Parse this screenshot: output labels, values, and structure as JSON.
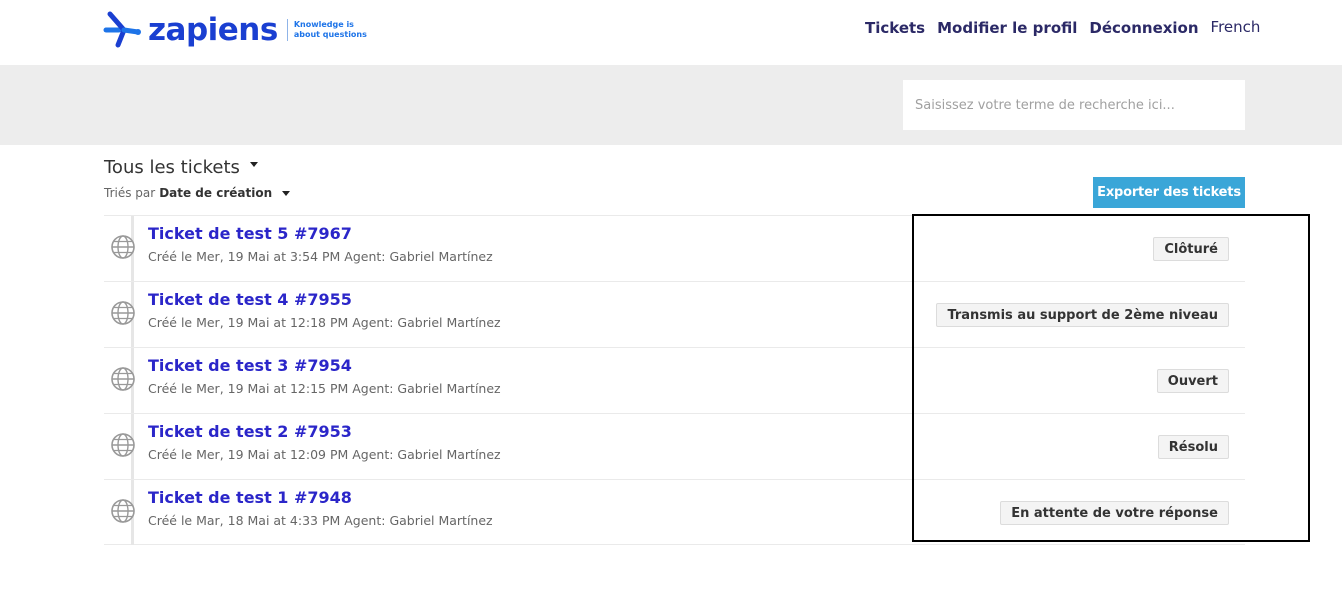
{
  "header": {
    "logo_word": "zapiens",
    "logo_tag_line1": "Knowledge is",
    "logo_tag_line2": "about questions",
    "nav": [
      {
        "label": "Tickets"
      },
      {
        "label": "Modifier le profil"
      },
      {
        "label": "Déconnexion"
      }
    ],
    "language": "French"
  },
  "search": {
    "placeholder": "Saisissez votre terme de recherche ici..."
  },
  "list": {
    "title": "Tous les tickets",
    "sort_prefix": "Triés par",
    "sort_value": "Date de création",
    "export_label": "Exporter des tickets"
  },
  "tickets": [
    {
      "title": "Ticket de test 5 #7967",
      "meta": "Créé le Mer, 19 Mai at 3:54 PM Agent: Gabriel Martínez",
      "status": "Clôturé"
    },
    {
      "title": "Ticket de test 4 #7955",
      "meta": "Créé le Mer, 19 Mai at 12:18 PM Agent: Gabriel Martínez",
      "status": "Transmis au support de 2ème niveau"
    },
    {
      "title": "Ticket de test 3 #7954",
      "meta": "Créé le Mer, 19 Mai at 12:15 PM Agent: Gabriel Martínez",
      "status": "Ouvert"
    },
    {
      "title": "Ticket de test 2 #7953",
      "meta": "Créé le Mer, 19 Mai at 12:09 PM Agent: Gabriel Martínez",
      "status": "Résolu"
    },
    {
      "title": "Ticket de test 1 #7948",
      "meta": "Créé le Mar, 18 Mai at 4:33 PM Agent: Gabriel Martínez",
      "status": "En attente de votre réponse"
    }
  ],
  "colors": {
    "brand": "#1a3fd1",
    "ticket_link": "#2b26c9",
    "export_button": "#3aa6d8",
    "nav": "#2b2966"
  },
  "icons": {
    "ticket_icon": "globe-icon",
    "list_caret": "caret-down-icon"
  }
}
